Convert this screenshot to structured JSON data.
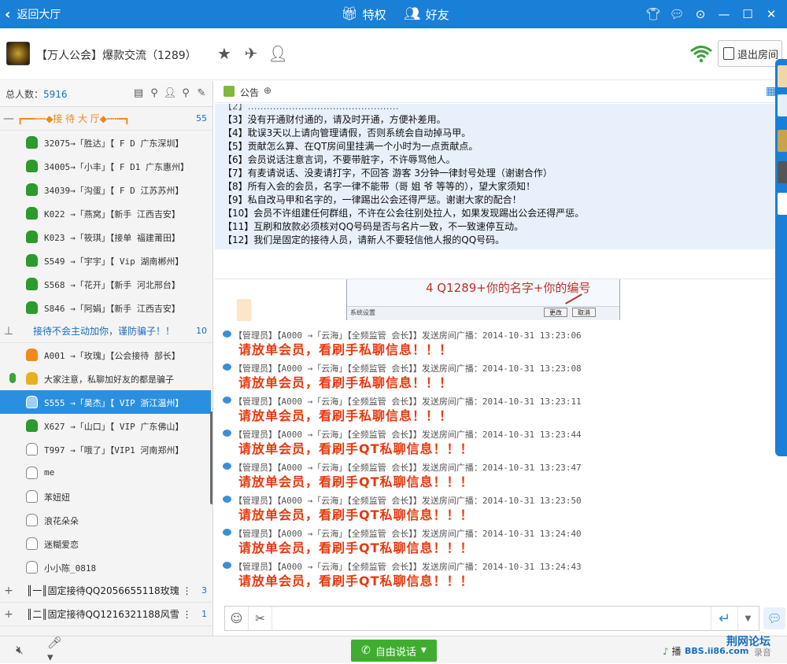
{
  "topbar": {
    "back_label": "返回大厅",
    "privilege_label": "特权",
    "friends_label": "好友"
  },
  "room": {
    "title": "【万人公会】爆款交流（1289）",
    "exit_label": "退出房间"
  },
  "left": {
    "total_label": "总人数：",
    "total_count": "5916",
    "groups": [
      {
        "label": "┏━━┅┅◆接  待 大 厅◆┅┅━┓",
        "count": "55"
      },
      {
        "label": "接待不会主动加你，谨防骗子！！",
        "count": "10"
      },
      {
        "label": "║一║固定接待QQ2056655118玫瑰 ⋮",
        "count": "3"
      },
      {
        "label": "║二║固定接待QQ1216321188风雪 ⋮",
        "count": "1"
      }
    ],
    "members": [
      {
        "text": "32075→「胜达」【 F D 广东深圳】",
        "avatar": "green"
      },
      {
        "text": "34005→「小丰」【 F D1 广东惠州】",
        "avatar": "green"
      },
      {
        "text": "34039→「沟蛋」【 F D  江苏苏州】",
        "avatar": "green"
      },
      {
        "text": "K022 →「燕窝」【新手 江西吉安】",
        "avatar": "green"
      },
      {
        "text": "K023 →「筱琪」【接单 福建莆田】",
        "avatar": "green"
      },
      {
        "text": "S549 →「宇宇」【 Vip 湖南郴州】",
        "avatar": "green"
      },
      {
        "text": "S568 →「花开」【新手 河北邢台】",
        "avatar": "green"
      },
      {
        "text": "S846 →「阿娟」【新手 江西吉安】",
        "avatar": "green"
      },
      {
        "text": "A001 →「玫瑰」【公会接待 部长】",
        "avatar": "orange"
      },
      {
        "text": "大家注意，私聊加好友的都是骗子",
        "avatar": "gold"
      },
      {
        "text": "S555 →「昊杰」【 VIP 浙江温州】",
        "avatar": "blue"
      },
      {
        "text": "X627 →「山口」【 VIP 广东佛山】",
        "avatar": "green"
      },
      {
        "text": "T997 →「哦了」【VIP1 河南郑州】",
        "avatar": "grey"
      },
      {
        "text": "me",
        "avatar": "grey"
      },
      {
        "text": "苯妞妞",
        "avatar": "grey"
      },
      {
        "text": "浪花朵朵",
        "avatar": "grey"
      },
      {
        "text": "迷糊爱恋",
        "avatar": "grey"
      },
      {
        "text": "小小陈_0818",
        "avatar": "grey"
      }
    ]
  },
  "announcement": {
    "label": "公告",
    "rules": [
      "【3】没有开通财付通的，请及时开通，方便补差用。",
      "【4】耽误3天以上请向管理请假，否则系统会自动掉马甲。",
      "【5】贡献怎么算、在QT房间里挂满一个小时为一点贡献点。",
      "【6】会员说话注意言词，不要带脏字，不许辱骂他人。",
      "【7】有麦请说话、没麦请打字，不回答 游客  3分钟一律封号处理（谢谢合作）",
      "【8】所有入会的会员，名字一律不能带（哥 姐  爷 等等的），望大家须知！",
      "【9】私自改马甲和名字的，一律踢出公会还得严惩。谢谢大家的配合！",
      "【10】会员不许组建任何群组，不许在公会往别处拉人，如果发现踢出公会还得严惩。",
      "【11】互刷和放款必须核对QQ号码是否与名片一致，不一致速停互动。",
      "【12】我们是固定的接待人员，请新人不要轻信他人报的QQ号码。"
    ]
  },
  "chat": {
    "image_caption": "4 Q1289+你的名字+你的编号",
    "image_left_text": "系统设置",
    "image_btn1": "更改",
    "image_btn2": "取消",
    "messages": [
      {
        "meta": "【管理员】【A000 →「云海」【全频监管 会长】】发送房间广播：2014-10-31 13:23:06",
        "body": "请放单会员，看刷手私聊信息！！！"
      },
      {
        "meta": "【管理员】【A000 →「云海」【全频监管 会长】】发送房间广播：2014-10-31 13:23:08",
        "body": "请放单会员，看刷手私聊信息！！！"
      },
      {
        "meta": "【管理员】【A000 →「云海」【全频监管 会长】】发送房间广播：2014-10-31 13:23:11",
        "body": "请放单会员，看刷手私聊信息！！！"
      },
      {
        "meta": "【管理员】【A000 →「云海」【全频监管 会长】】发送房间广播：2014-10-31 13:23:44",
        "body": "请放单会员，看刷手QT私聊信息！！！"
      },
      {
        "meta": "【管理员】【A000 →「云海」【全频监管 会长】】发送房间广播：2014-10-31 13:23:47",
        "body": "请放单会员，看刷手QT私聊信息！！！"
      },
      {
        "meta": "【管理员】【A000 →「云海」【全频监管 会长】】发送房间广播：2014-10-31 13:23:50",
        "body": "请放单会员，看刷手QT私聊信息！！！"
      },
      {
        "meta": "【管理员】【A000 →「云海」【全频监管 会长】】发送房间广播：2014-10-31 13:24:40",
        "body": "请放单会员，看刷手QT私聊信息！！！"
      },
      {
        "meta": "【管理员】【A000 →「云海」【全频监管 会长】】发送房间广播：2014-10-31 13:24:43",
        "body": "请放单会员，看刷手QT私聊信息！！！"
      }
    ]
  },
  "bottom": {
    "free_talk_label": "自由说话",
    "record_label": "播",
    "watermark_site": "荆网论坛",
    "watermark_url": "BBS.ii86.com",
    "watermark_tail": "录音"
  },
  "colors": {
    "accent": "#1a7fd6",
    "selected_row": "#2b8fe0",
    "broadcast_text": "#e8380e",
    "announcement_bg": "#e8f1fb",
    "free_talk": "#3fae2f"
  }
}
